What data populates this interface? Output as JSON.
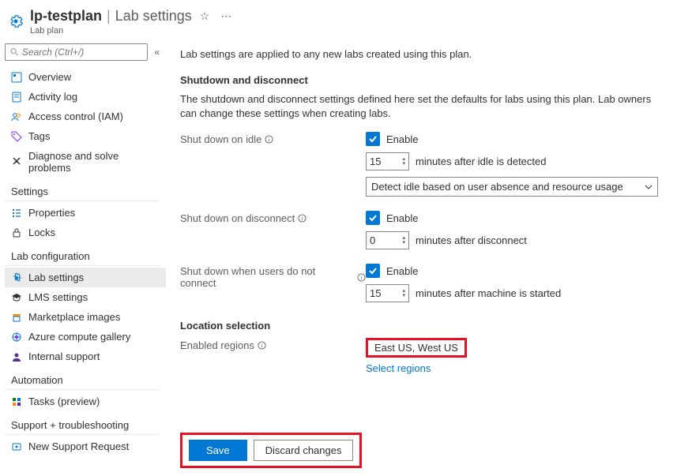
{
  "header": {
    "name": "lp-testplan",
    "section": "Lab settings",
    "resource_type": "Lab plan"
  },
  "sidebar": {
    "search_placeholder": "Search (Ctrl+/)",
    "items_top": [
      {
        "label": "Overview",
        "icon": "overview"
      },
      {
        "label": "Activity log",
        "icon": "activity"
      },
      {
        "label": "Access control (IAM)",
        "icon": "access"
      },
      {
        "label": "Tags",
        "icon": "tags"
      },
      {
        "label": "Diagnose and solve problems",
        "icon": "diagnose"
      }
    ],
    "group_settings": "Settings",
    "items_settings": [
      {
        "label": "Properties",
        "icon": "properties"
      },
      {
        "label": "Locks",
        "icon": "locks"
      }
    ],
    "group_labconfig": "Lab configuration",
    "items_labconfig": [
      {
        "label": "Lab settings",
        "icon": "gear",
        "selected": true
      },
      {
        "label": "LMS settings",
        "icon": "lms"
      },
      {
        "label": "Marketplace images",
        "icon": "marketplace"
      },
      {
        "label": "Azure compute gallery",
        "icon": "gallery"
      },
      {
        "label": "Internal support",
        "icon": "support"
      }
    ],
    "group_automation": "Automation",
    "items_automation": [
      {
        "label": "Tasks (preview)",
        "icon": "tasks"
      }
    ],
    "group_support": "Support + troubleshooting",
    "items_support": [
      {
        "label": "New Support Request",
        "icon": "newsupport"
      }
    ]
  },
  "main": {
    "intro": "Lab settings are applied to any new labs created using this plan.",
    "shutdown_h": "Shutdown and disconnect",
    "shutdown_desc": "The shutdown and disconnect settings defined here set the defaults for labs using this plan. Lab owners can change these settings when creating labs.",
    "idle_label": "Shut down on idle",
    "idle_enable": "Enable",
    "idle_minutes": "15",
    "idle_suffix": "minutes after idle is detected",
    "idle_dropdown": "Detect idle based on user absence and resource usage",
    "disc_label": "Shut down on disconnect",
    "disc_enable": "Enable",
    "disc_minutes": "0",
    "disc_suffix": "minutes after disconnect",
    "noconn_label": "Shut down when users do not connect",
    "noconn_enable": "Enable",
    "noconn_minutes": "15",
    "noconn_suffix": "minutes after machine is started",
    "loc_h": "Location selection",
    "regions_label": "Enabled regions",
    "regions_val": "East US, West US",
    "select_regions": "Select regions",
    "save": "Save",
    "discard": "Discard changes"
  }
}
